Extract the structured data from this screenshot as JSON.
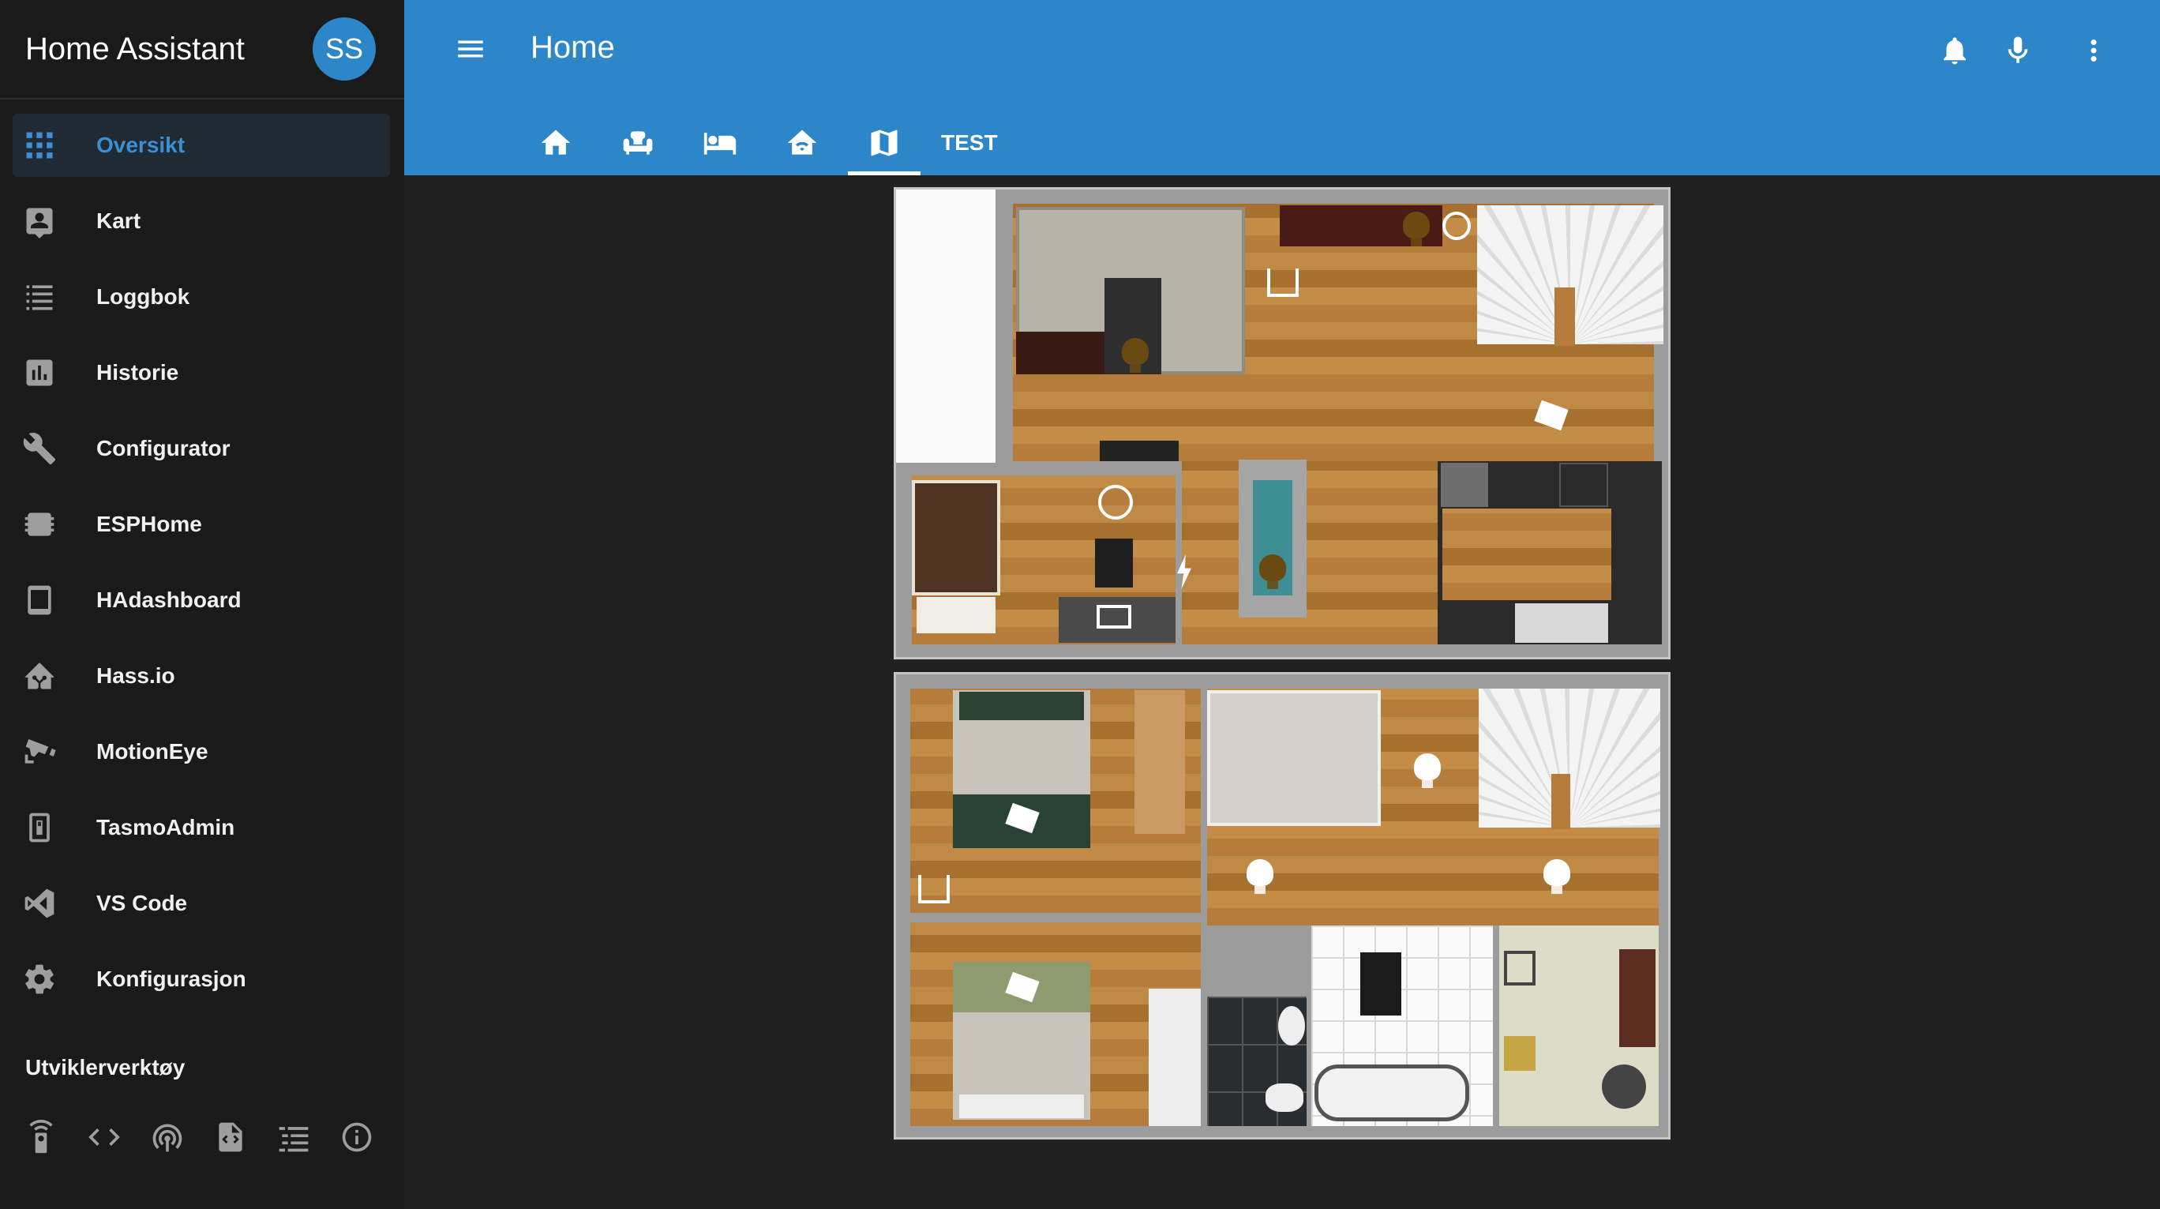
{
  "app": {
    "title": "Home Assistant",
    "user_initials": "SS"
  },
  "sidebar": {
    "items": [
      {
        "label": "Oversikt",
        "icon": "grid-icon",
        "active": true
      },
      {
        "label": "Kart",
        "icon": "account-box-icon"
      },
      {
        "label": "Loggbok",
        "icon": "format-list-bulleted-icon"
      },
      {
        "label": "Historie",
        "icon": "chart-box-icon"
      },
      {
        "label": "Configurator",
        "icon": "wrench-icon"
      },
      {
        "label": "ESPHome",
        "icon": "chip-icon"
      },
      {
        "label": "HAdashboard",
        "icon": "tablet-icon"
      },
      {
        "label": "Hass.io",
        "icon": "home-assistant-icon"
      },
      {
        "label": "MotionEye",
        "icon": "cctv-icon"
      },
      {
        "label": "TasmoAdmin",
        "icon": "switch-device-icon"
      },
      {
        "label": "VS Code",
        "icon": "vscode-icon"
      },
      {
        "label": "Konfigurasjon",
        "icon": "gear-icon"
      }
    ],
    "developer_tools_title": "Utviklerverktøy",
    "developer_tools": [
      "remote-icon",
      "code-brackets-icon",
      "access-point-icon",
      "file-code-icon",
      "format-list-icon",
      "info-icon"
    ]
  },
  "header": {
    "title": "Home",
    "tabs": [
      {
        "icon": "home-icon"
      },
      {
        "icon": "sofa-icon"
      },
      {
        "icon": "bed-icon"
      },
      {
        "icon": "home-wifi-icon"
      },
      {
        "icon": "map-icon",
        "active": true
      },
      {
        "label": "TEST"
      }
    ],
    "actions": [
      "bell-icon",
      "microphone-icon",
      "dots-vertical-icon"
    ]
  },
  "colors": {
    "primary": "#2d86c7",
    "sidebar_bg": "#1a1a1a",
    "content_bg": "#202020",
    "active_accent": "#3b8fd4"
  }
}
